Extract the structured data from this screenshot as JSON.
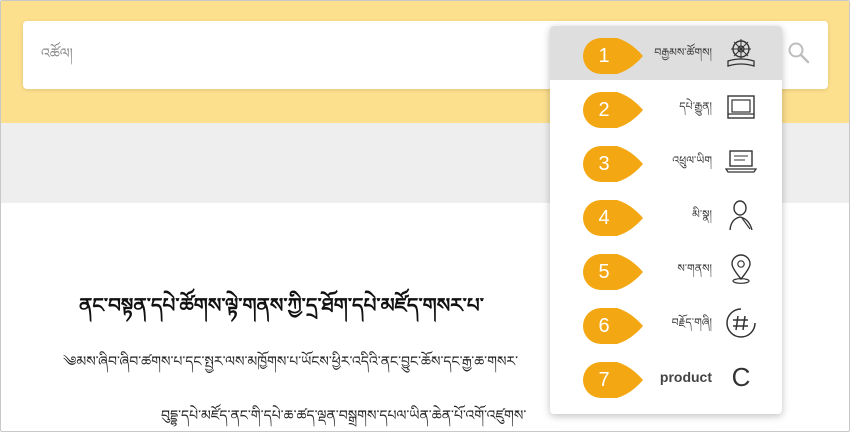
{
  "search": {
    "placeholder": "འཚོལ།"
  },
  "page": {
    "heading": "ནང་བསྟན་དཔེ་ཚོགས་ལྟེ་གནས་ཀྱི་དྲ་ཐོག་དཔེ་མཛོད་གསར་པ་",
    "line1": "༄མས་ཞིབ་ཞིབ་ཚགས་པ་དང་སྤྱར་ལས་མཁྱོགས་པ་ཡོངས་ཕྱིར་འདིའི་ནང་བྱུང་ཆོས་དང་རྒྱ་ཆ་གསར་",
    "line2": "བུདྡྷ་དཔེ་མཛོད་ནང་གི་དཔེ་ཆ་ཚད་ལྡན་བསྒྲགས་དཔལ་ཡིན་ཆེན་པོ་འགོ་འཛུགས་"
  },
  "dropdown": {
    "items": [
      {
        "badge": "1",
        "label": "བརྒྱམས་ཚོགས།",
        "icon": "dharma-wheel-book-icon",
        "active": true
      },
      {
        "badge": "2",
        "label": "དཔེ་རྒྱུན།",
        "icon": "book-box-icon",
        "active": false
      },
      {
        "badge": "3",
        "label": "འཕྲུལ་ཡིག",
        "icon": "laptop-icon",
        "active": false
      },
      {
        "badge": "4",
        "label": "མི་སྣ།",
        "icon": "monk-icon",
        "active": false
      },
      {
        "badge": "5",
        "label": "ས་གནས།",
        "icon": "map-pin-icon",
        "active": false
      },
      {
        "badge": "6",
        "label": "བརྗོད་གཞི།",
        "icon": "hashtag-icon",
        "active": false
      },
      {
        "badge": "7",
        "label": "product",
        "icon": "letter-c-icon",
        "icon_text": "C",
        "active": false
      }
    ]
  },
  "colors": {
    "top_band": "#fde08e",
    "grey_band": "#eeeeee",
    "badge": "#f3a712",
    "active_row": "#dedede"
  }
}
